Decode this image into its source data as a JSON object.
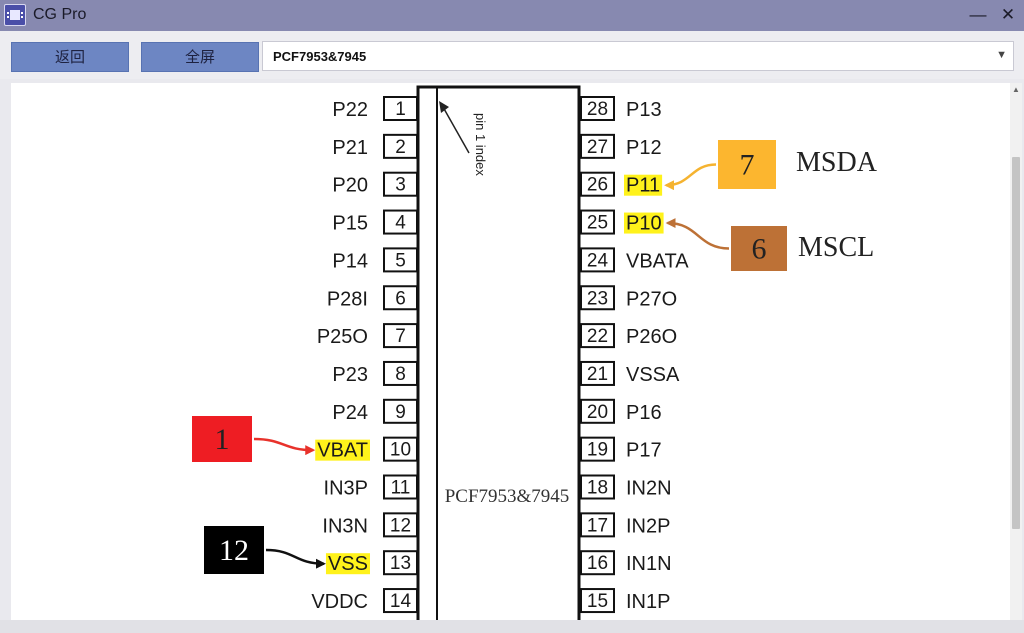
{
  "window": {
    "title": "CG Pro",
    "minimize_glyph": "—",
    "close_glyph": "✕"
  },
  "toolbar": {
    "back_label": "返回",
    "fullscreen_label": "全屏"
  },
  "chip_select": {
    "value": "PCF7953&7945",
    "arrow_icon": "chevron-down-icon"
  },
  "diagram": {
    "chip_name": "PCF7953&7945",
    "pin1_note": "pin 1 index",
    "left_pins": [
      {
        "num": "1",
        "label": "P22",
        "highlight": false
      },
      {
        "num": "2",
        "label": "P21",
        "highlight": false
      },
      {
        "num": "3",
        "label": "P20",
        "highlight": false
      },
      {
        "num": "4",
        "label": "P15",
        "highlight": false
      },
      {
        "num": "5",
        "label": "P14",
        "highlight": false
      },
      {
        "num": "6",
        "label": "P28I",
        "highlight": false
      },
      {
        "num": "7",
        "label": "P25O",
        "highlight": false
      },
      {
        "num": "8",
        "label": "P23",
        "highlight": false
      },
      {
        "num": "9",
        "label": "P24",
        "highlight": false
      },
      {
        "num": "10",
        "label": "VBAT",
        "highlight": true
      },
      {
        "num": "11",
        "label": "IN3P",
        "highlight": false
      },
      {
        "num": "12",
        "label": "IN3N",
        "highlight": false
      },
      {
        "num": "13",
        "label": "VSS",
        "highlight": true
      },
      {
        "num": "14",
        "label": "VDDC",
        "highlight": false
      }
    ],
    "right_pins": [
      {
        "num": "28",
        "label": "P13",
        "highlight": false
      },
      {
        "num": "27",
        "label": "P12",
        "highlight": false
      },
      {
        "num": "26",
        "label": "P11",
        "highlight": true
      },
      {
        "num": "25",
        "label": "P10",
        "highlight": true
      },
      {
        "num": "24",
        "label": "VBATA",
        "highlight": false
      },
      {
        "num": "23",
        "label": "P27O",
        "highlight": false
      },
      {
        "num": "22",
        "label": "P26O",
        "highlight": false
      },
      {
        "num": "21",
        "label": "VSSA",
        "highlight": false
      },
      {
        "num": "20",
        "label": "P16",
        "highlight": false
      },
      {
        "num": "19",
        "label": "P17",
        "highlight": false
      },
      {
        "num": "18",
        "label": "IN2N",
        "highlight": false
      },
      {
        "num": "17",
        "label": "IN2P",
        "highlight": false
      },
      {
        "num": "16",
        "label": "IN1N",
        "highlight": false
      },
      {
        "num": "15",
        "label": "IN1P",
        "highlight": false
      }
    ],
    "callouts": [
      {
        "number": "1",
        "target_pin": "VBAT",
        "box_color": "#ee1d23",
        "text_color": "#222222",
        "arrow_color": "#e8322b",
        "caption": ""
      },
      {
        "number": "12",
        "target_pin": "VSS",
        "box_color": "#000000",
        "text_color": "#ffffff",
        "arrow_color": "#111111",
        "caption": ""
      },
      {
        "number": "7",
        "target_pin": "P11",
        "box_color": "#fcb62f",
        "text_color": "#222222",
        "arrow_color": "#f5b330",
        "caption": "MSDA"
      },
      {
        "number": "6",
        "target_pin": "P10",
        "box_color": "#bd7136",
        "text_color": "#222222",
        "arrow_color": "#bd7136",
        "caption": "MSCL"
      }
    ],
    "highlight_color": "#fff21b"
  }
}
